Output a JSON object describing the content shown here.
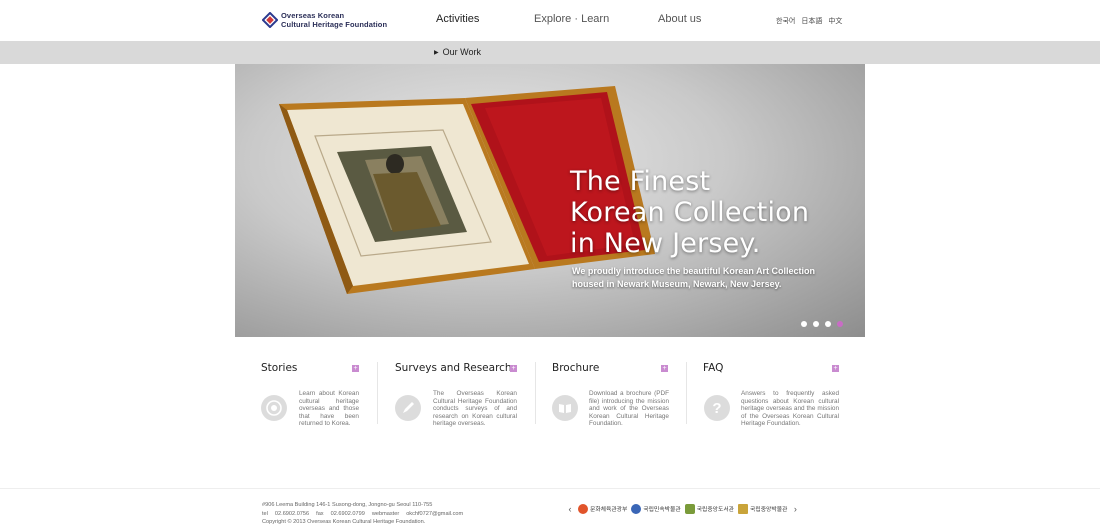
{
  "header": {
    "logo_line1": "Overseas Korean",
    "logo_line2": "Cultural Heritage Foundation",
    "nav": {
      "activities": "Activities",
      "explore": "Explore · Learn",
      "about": "About us"
    },
    "languages": [
      "한국어",
      "日本語",
      "中文"
    ]
  },
  "subnav": {
    "current": "Our Work"
  },
  "hero": {
    "title_line1": "The Finest",
    "title_line2": "Korean Collection",
    "title_line3": "in New Jersey.",
    "subtitle": "We proudly introduce the beautiful Korean Art Collection housed in Newark Museum, Newark, New Jersey.",
    "slide_count": 4,
    "active_slide": 4,
    "accent_color": "#c96cc6"
  },
  "cards": [
    {
      "title": "Stories",
      "icon": "target-icon",
      "text": "Learn about Korean cultural heritage overseas and those that have been returned to Korea."
    },
    {
      "title": "Surveys and Research",
      "icon": "pencil-icon",
      "text": "The Overseas Korean Cultural Heritage Foundation conducts surveys of and research on Korean cultural heritage overseas."
    },
    {
      "title": "Brochure",
      "icon": "book-icon",
      "text": "Download a brochure (PDF file) introducing the mission and work of the Overseas Korean Cultural Heritage Foundation."
    },
    {
      "title": "FAQ",
      "icon": "question-icon",
      "text": "Answers to frequently asked questions about Korean cultural heritage overseas and the mission of the Overseas Korean Cultural Heritage Foundation."
    }
  ],
  "footer": {
    "address": "#906 Leema Building 146-1 Susong-dong, Jongno-gu Seoul 110-755",
    "tel_label": "tel",
    "tel": "02.6902.0756",
    "fax_label": "fax",
    "fax": "02.6902.0799",
    "webmaster_label": "webmaster",
    "email": "okchf0727@gmail.com",
    "copyright": "Copyright © 2013 Overseas Korean Cultural Heritage Foundation.",
    "partners": [
      "문화체육관광부",
      "국립민속박물관",
      "국립중앙도서관",
      "국립중앙박물관"
    ]
  }
}
